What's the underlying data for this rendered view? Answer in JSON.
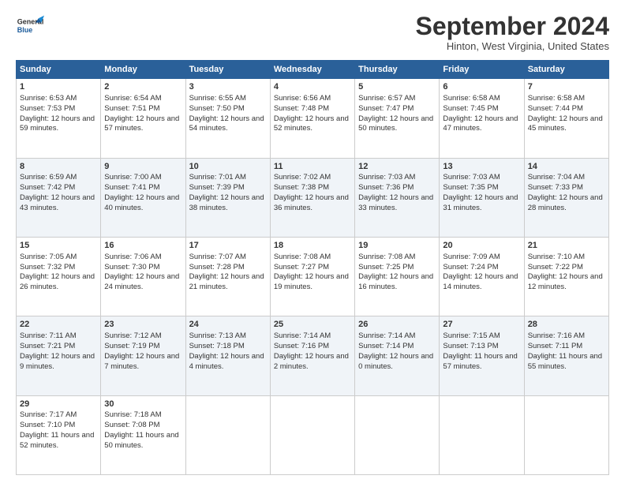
{
  "header": {
    "logo_line1": "General",
    "logo_line2": "Blue",
    "month": "September 2024",
    "location": "Hinton, West Virginia, United States"
  },
  "days_of_week": [
    "Sunday",
    "Monday",
    "Tuesday",
    "Wednesday",
    "Thursday",
    "Friday",
    "Saturday"
  ],
  "weeks": [
    [
      {
        "day": "1",
        "sunrise": "6:53 AM",
        "sunset": "7:53 PM",
        "daylight": "12 hours and 59 minutes."
      },
      {
        "day": "2",
        "sunrise": "6:54 AM",
        "sunset": "7:51 PM",
        "daylight": "12 hours and 57 minutes."
      },
      {
        "day": "3",
        "sunrise": "6:55 AM",
        "sunset": "7:50 PM",
        "daylight": "12 hours and 54 minutes."
      },
      {
        "day": "4",
        "sunrise": "6:56 AM",
        "sunset": "7:48 PM",
        "daylight": "12 hours and 52 minutes."
      },
      {
        "day": "5",
        "sunrise": "6:57 AM",
        "sunset": "7:47 PM",
        "daylight": "12 hours and 50 minutes."
      },
      {
        "day": "6",
        "sunrise": "6:58 AM",
        "sunset": "7:45 PM",
        "daylight": "12 hours and 47 minutes."
      },
      {
        "day": "7",
        "sunrise": "6:58 AM",
        "sunset": "7:44 PM",
        "daylight": "12 hours and 45 minutes."
      }
    ],
    [
      {
        "day": "8",
        "sunrise": "6:59 AM",
        "sunset": "7:42 PM",
        "daylight": "12 hours and 43 minutes."
      },
      {
        "day": "9",
        "sunrise": "7:00 AM",
        "sunset": "7:41 PM",
        "daylight": "12 hours and 40 minutes."
      },
      {
        "day": "10",
        "sunrise": "7:01 AM",
        "sunset": "7:39 PM",
        "daylight": "12 hours and 38 minutes."
      },
      {
        "day": "11",
        "sunrise": "7:02 AM",
        "sunset": "7:38 PM",
        "daylight": "12 hours and 36 minutes."
      },
      {
        "day": "12",
        "sunrise": "7:03 AM",
        "sunset": "7:36 PM",
        "daylight": "12 hours and 33 minutes."
      },
      {
        "day": "13",
        "sunrise": "7:03 AM",
        "sunset": "7:35 PM",
        "daylight": "12 hours and 31 minutes."
      },
      {
        "day": "14",
        "sunrise": "7:04 AM",
        "sunset": "7:33 PM",
        "daylight": "12 hours and 28 minutes."
      }
    ],
    [
      {
        "day": "15",
        "sunrise": "7:05 AM",
        "sunset": "7:32 PM",
        "daylight": "12 hours and 26 minutes."
      },
      {
        "day": "16",
        "sunrise": "7:06 AM",
        "sunset": "7:30 PM",
        "daylight": "12 hours and 24 minutes."
      },
      {
        "day": "17",
        "sunrise": "7:07 AM",
        "sunset": "7:28 PM",
        "daylight": "12 hours and 21 minutes."
      },
      {
        "day": "18",
        "sunrise": "7:08 AM",
        "sunset": "7:27 PM",
        "daylight": "12 hours and 19 minutes."
      },
      {
        "day": "19",
        "sunrise": "7:08 AM",
        "sunset": "7:25 PM",
        "daylight": "12 hours and 16 minutes."
      },
      {
        "day": "20",
        "sunrise": "7:09 AM",
        "sunset": "7:24 PM",
        "daylight": "12 hours and 14 minutes."
      },
      {
        "day": "21",
        "sunrise": "7:10 AM",
        "sunset": "7:22 PM",
        "daylight": "12 hours and 12 minutes."
      }
    ],
    [
      {
        "day": "22",
        "sunrise": "7:11 AM",
        "sunset": "7:21 PM",
        "daylight": "12 hours and 9 minutes."
      },
      {
        "day": "23",
        "sunrise": "7:12 AM",
        "sunset": "7:19 PM",
        "daylight": "12 hours and 7 minutes."
      },
      {
        "day": "24",
        "sunrise": "7:13 AM",
        "sunset": "7:18 PM",
        "daylight": "12 hours and 4 minutes."
      },
      {
        "day": "25",
        "sunrise": "7:14 AM",
        "sunset": "7:16 PM",
        "daylight": "12 hours and 2 minutes."
      },
      {
        "day": "26",
        "sunrise": "7:14 AM",
        "sunset": "7:14 PM",
        "daylight": "12 hours and 0 minutes."
      },
      {
        "day": "27",
        "sunrise": "7:15 AM",
        "sunset": "7:13 PM",
        "daylight": "11 hours and 57 minutes."
      },
      {
        "day": "28",
        "sunrise": "7:16 AM",
        "sunset": "7:11 PM",
        "daylight": "11 hours and 55 minutes."
      }
    ],
    [
      {
        "day": "29",
        "sunrise": "7:17 AM",
        "sunset": "7:10 PM",
        "daylight": "11 hours and 52 minutes."
      },
      {
        "day": "30",
        "sunrise": "7:18 AM",
        "sunset": "7:08 PM",
        "daylight": "11 hours and 50 minutes."
      },
      null,
      null,
      null,
      null,
      null
    ]
  ]
}
